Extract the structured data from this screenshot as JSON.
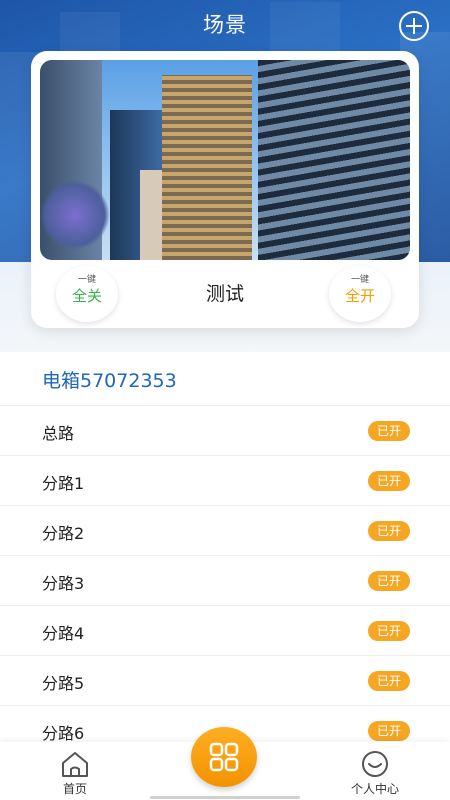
{
  "header": {
    "title": "场景",
    "add_icon": "plus-circle-icon",
    "background_color": "#1e56a8"
  },
  "scene_card": {
    "name": "测试",
    "photo": "city-skyscrapers-photo",
    "all_off": {
      "small": "一键",
      "big": "全关",
      "color": "#37b34a"
    },
    "all_on": {
      "small": "一键",
      "big": "全开",
      "color": "#f0a000"
    }
  },
  "device": {
    "title": "电箱57072353",
    "title_color": "#1f67b8"
  },
  "circuits": [
    {
      "name": "总路",
      "status": "已开"
    },
    {
      "name": "分路1",
      "status": "已开"
    },
    {
      "name": "分路2",
      "status": "已开"
    },
    {
      "name": "分路3",
      "status": "已开"
    },
    {
      "name": "分路4",
      "status": "已开"
    },
    {
      "name": "分路5",
      "status": "已开"
    },
    {
      "name": "分路6",
      "status": "已开"
    }
  ],
  "status_badge_color": "#f5a623",
  "tabbar": {
    "home": {
      "label": "首页",
      "icon": "home-icon"
    },
    "center": {
      "icon": "grid-icon",
      "color": "#f39200"
    },
    "me": {
      "label": "个人中心",
      "icon": "user-face-icon"
    }
  }
}
